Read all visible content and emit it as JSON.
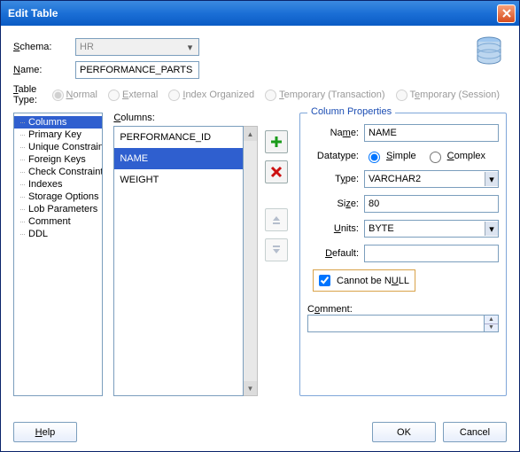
{
  "window": {
    "title": "Edit Table"
  },
  "header": {
    "schema_label": "Schema:",
    "schema_value": "HR",
    "name_label": "Name:",
    "name_value": "PERFORMANCE_PARTS",
    "tabletype_label": "Table Type:",
    "radios": {
      "normal": "Normal",
      "external": "External",
      "index_org": "Index Organized",
      "temp_tx": "Temporary (Transaction)",
      "temp_sess": "Temporary (Session)"
    }
  },
  "tree": {
    "items": [
      "Columns",
      "Primary Key",
      "Unique Constrain",
      "Foreign Keys",
      "Check Constraint",
      "Indexes",
      "Storage Options",
      "Lob Parameters",
      "Comment",
      "DDL"
    ],
    "selected_index": 0
  },
  "columns": {
    "heading": "Columns:",
    "items": [
      "PERFORMANCE_ID",
      "NAME",
      "WEIGHT"
    ],
    "selected_index": 1
  },
  "props": {
    "legend": "Column Properties",
    "name_label": "Name:",
    "name_value": "NAME",
    "datatype_label": "Datatype:",
    "datatype_simple": "Simple",
    "datatype_complex": "Complex",
    "type_label": "Type:",
    "type_value": "VARCHAR2",
    "size_label": "Size:",
    "size_value": "80",
    "units_label": "Units:",
    "units_value": "BYTE",
    "default_label": "Default:",
    "default_value": "",
    "notnull_label": "Cannot be NULL",
    "comment_label": "Comment:",
    "comment_value": ""
  },
  "buttons": {
    "help": "Help",
    "ok": "OK",
    "cancel": "Cancel"
  },
  "underlines": {
    "schema": "S",
    "name": "N",
    "tabletype": "T",
    "normal": "N",
    "external": "E",
    "index": "I",
    "temp_tx": "T",
    "temp_sess": "e",
    "columns_h": "C",
    "propname": "m",
    "simple": "S",
    "complex": "C",
    "type": "y",
    "size": "z",
    "units": "U",
    "default": "D",
    "notnull": "U",
    "comment": "o",
    "help": "H"
  }
}
